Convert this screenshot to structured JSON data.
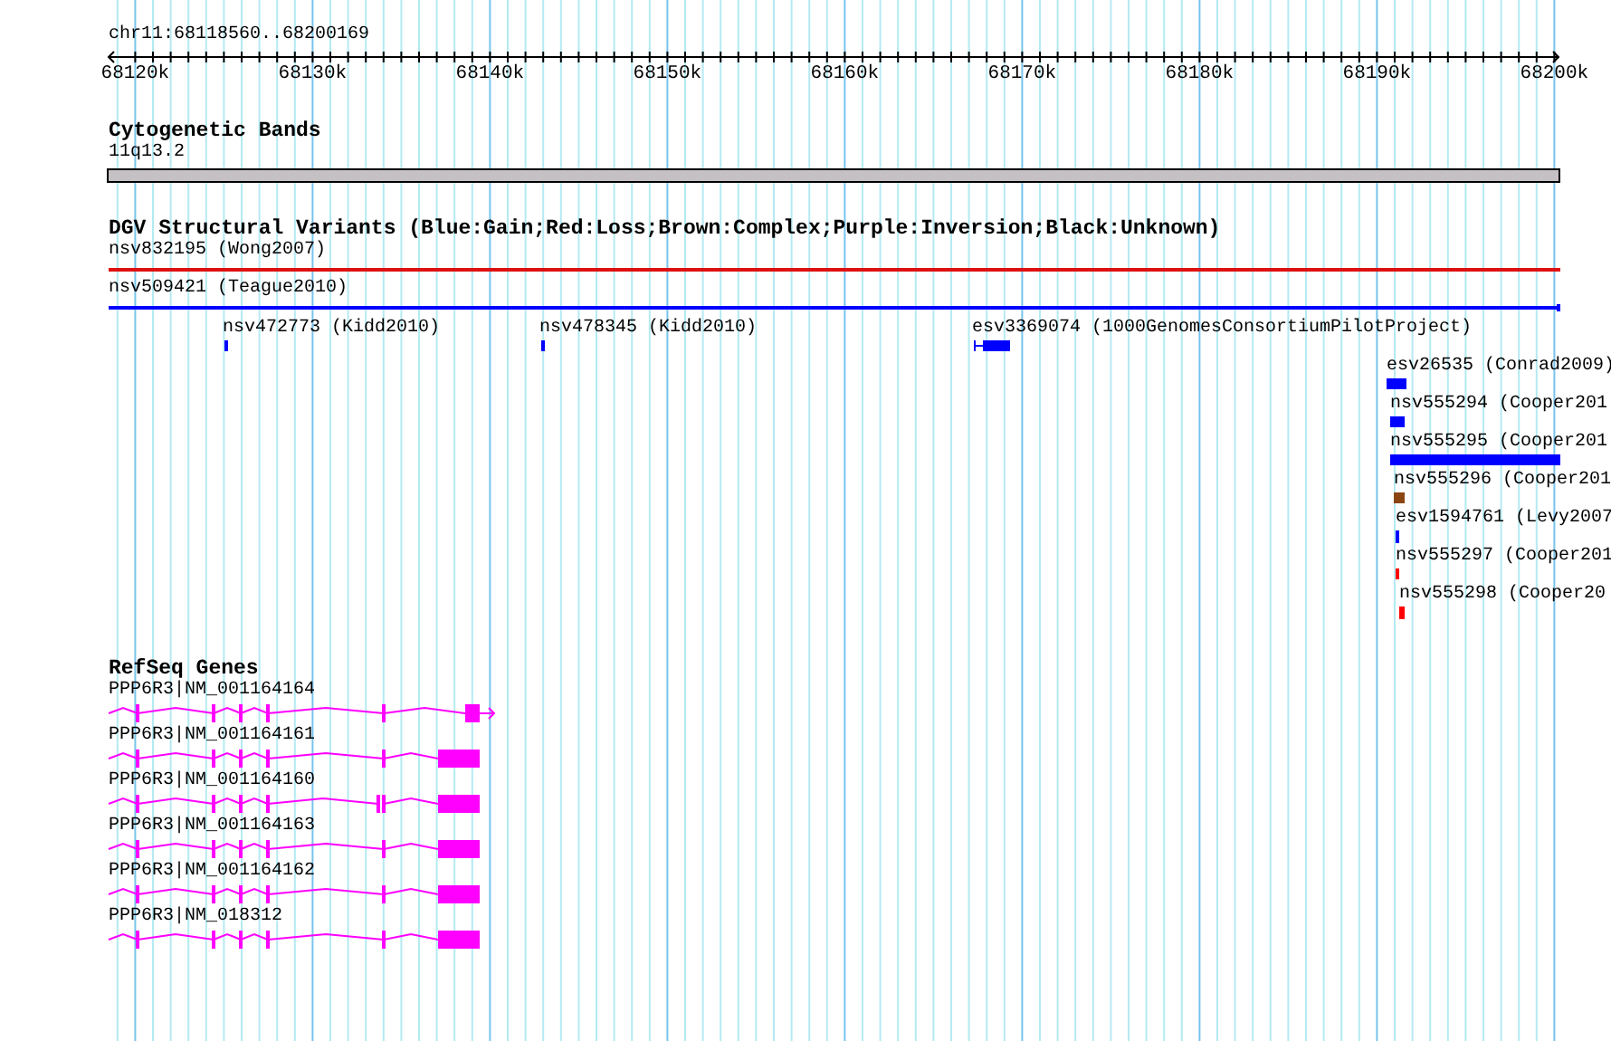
{
  "ruler": {
    "position": "chr11:68118560..68200169",
    "ticks": [
      "68120k",
      "68130k",
      "68140k",
      "68150k",
      "68160k",
      "68170k",
      "68180k",
      "68190k",
      "68200k"
    ]
  },
  "tracks": [
    {
      "kind": "bands",
      "title": "Cytogenetic Bands",
      "features": [
        {
          "label": "11q13.2"
        }
      ]
    },
    {
      "kind": "variants",
      "title": "DGV Structural Variants (Blue:Gain;Red:Loss;Brown:Complex;Purple:Inversion;Black:Unknown)",
      "features": [
        {
          "label": "nsv832195 (Wong2007)",
          "color": "#dd1111"
        },
        {
          "label": "nsv509421 (Teague2010)",
          "color": "#0000ff"
        },
        {
          "label": "nsv472773 (Kidd2010)",
          "color": "#0000ff"
        },
        {
          "label": "nsv478345 (Kidd2010)",
          "color": "#0000ff"
        },
        {
          "label": "esv3369074 (1000GenomesConsortiumPilotProject)",
          "color": "#0000ff"
        },
        {
          "label": "esv26535 (Conrad2009)",
          "color": "#0000ff"
        },
        {
          "label": "nsv555294 (Cooper201",
          "color": "#0000ff"
        },
        {
          "label": "nsv555295 (Cooper201",
          "color": "#0000ff"
        },
        {
          "label": "nsv555296 (Cooper201",
          "color": "#8b4513"
        },
        {
          "label": "esv1594761 (Levy2007",
          "color": "#0000ff"
        },
        {
          "label": "nsv555297 (Cooper201",
          "color": "#ff0000"
        },
        {
          "label": "nsv555298 (Cooper20",
          "color": "#ff0000"
        }
      ]
    },
    {
      "kind": "genes",
      "title": "RefSeq Genes",
      "features": [
        {
          "label": "PPP6R3|NM_001164164"
        },
        {
          "label": "PPP6R3|NM_001164161"
        },
        {
          "label": "PPP6R3|NM_001164160"
        },
        {
          "label": "PPP6R3|NM_001164163"
        },
        {
          "label": "PPP6R3|NM_001164162"
        },
        {
          "label": "PPP6R3|NM_018312"
        }
      ]
    }
  ]
}
